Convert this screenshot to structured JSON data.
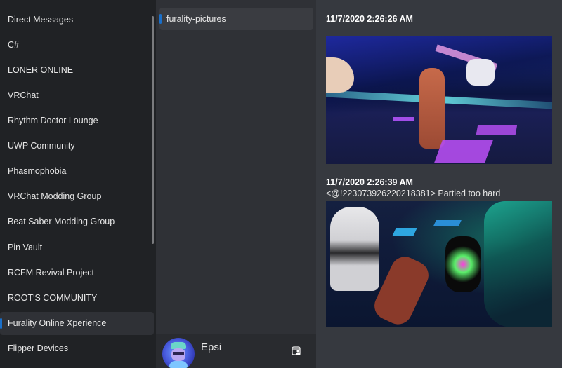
{
  "servers": {
    "items": [
      {
        "label": "Direct Messages",
        "selected": false
      },
      {
        "label": "C#",
        "selected": false
      },
      {
        "label": "LONER ONLINE",
        "selected": false
      },
      {
        "label": "VRChat",
        "selected": false
      },
      {
        "label": "Rhythm Doctor Lounge",
        "selected": false
      },
      {
        "label": "UWP Community",
        "selected": false
      },
      {
        "label": "Phasmophobia",
        "selected": false
      },
      {
        "label": "VRChat Modding Group",
        "selected": false
      },
      {
        "label": "Beat Saber Modding Group",
        "selected": false
      },
      {
        "label": "Pin Vault",
        "selected": false
      },
      {
        "label": "RCFM Revival Project",
        "selected": false
      },
      {
        "label": "ROOT'S COMMUNITY",
        "selected": false
      },
      {
        "label": "Furality Online Xperience",
        "selected": true
      },
      {
        "label": "Flipper Devices",
        "selected": false
      }
    ]
  },
  "channels": {
    "items": [
      {
        "label": "furality-pictures",
        "selected": true
      }
    ]
  },
  "user": {
    "name": "Epsi",
    "avatar_icon": "user-avatar",
    "settings_icon": "settings-icon"
  },
  "messages": [
    {
      "timestamp": "11/7/2020 2:26:26 AM",
      "text": "",
      "attachment": "image-attachment"
    },
    {
      "timestamp": "11/7/2020 2:26:39 AM",
      "text": "<@!223073926220218381> Partied too hard",
      "attachment": "image-attachment"
    }
  ],
  "colors": {
    "accent": "#1a6fc9",
    "server_bg": "#202225",
    "channel_bg": "#2f3136",
    "messages_bg": "#36393f"
  }
}
